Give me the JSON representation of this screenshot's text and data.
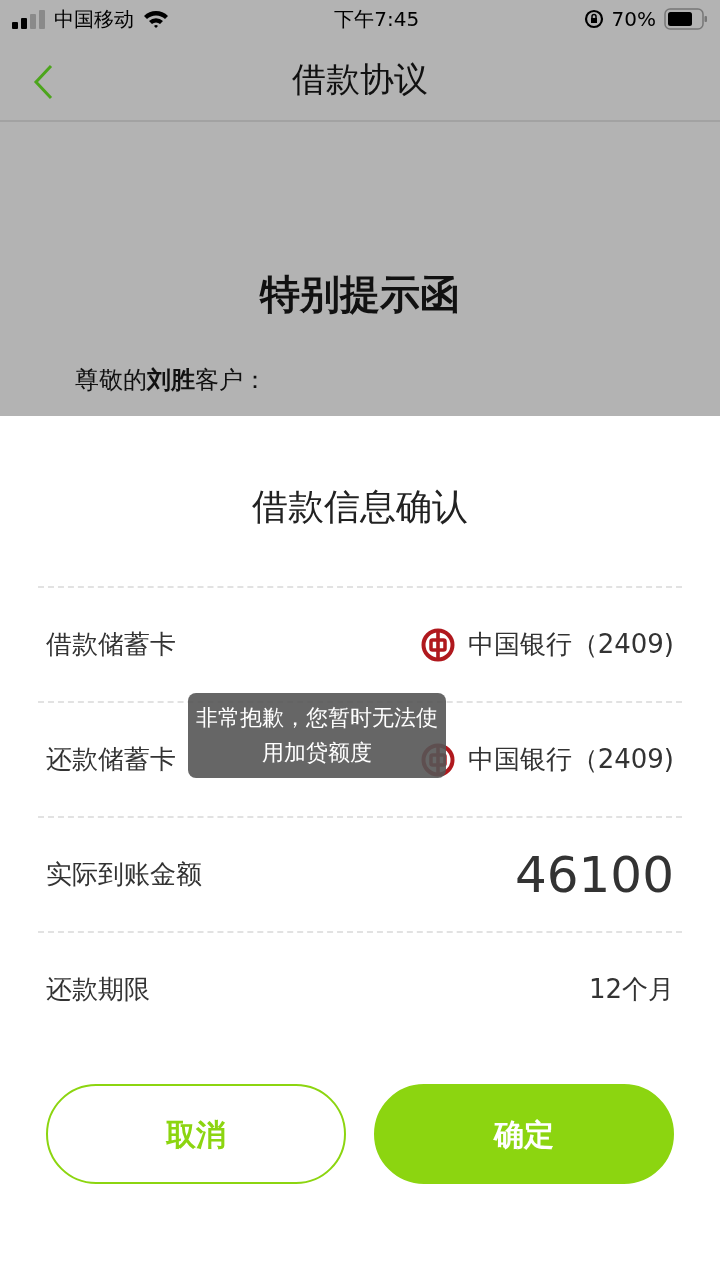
{
  "status_bar": {
    "carrier": "中国移动",
    "time": "下午7:45",
    "battery": "70%"
  },
  "nav": {
    "title": "借款协议"
  },
  "agreement": {
    "heading": "特别提示函",
    "greeting": "尊敬的**刘胜**客户："
  },
  "sheet": {
    "title": "借款信息确认",
    "rows": [
      {
        "kind": "bank",
        "label": "借款储蓄卡",
        "value": "中国银行（2409)"
      },
      {
        "kind": "bank",
        "label": "还款储蓄卡",
        "value": "中国银行（2409)"
      },
      {
        "kind": "amount",
        "label": "实际到账金额",
        "value": "46100"
      },
      {
        "kind": "text",
        "label": "还款期限",
        "value": "12个月"
      }
    ],
    "buttons": [
      {
        "kind": "secondary",
        "label": "取消"
      },
      {
        "kind": "primary",
        "label": "确定"
      }
    ]
  },
  "toast": {
    "text": "非常抱歉，您暂时无法使用加贷额度"
  }
}
